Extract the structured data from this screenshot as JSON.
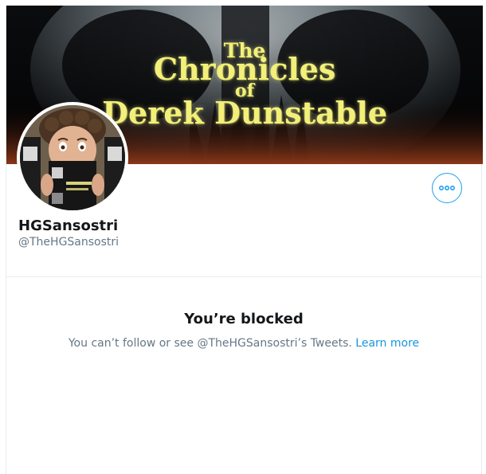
{
  "profile": {
    "banner": {
      "line1": "The",
      "line2": "Chronicles",
      "line3": "of",
      "line4": "Derek Dunstable"
    },
    "display_name": "HGSansostri",
    "handle": "@TheHGSansostri",
    "more_icon": "more-horizontal-icon"
  },
  "blocked": {
    "title": "You’re blocked",
    "message": "You can’t follow or see @TheHGSansostri’s Tweets.",
    "link_label": "Learn more"
  },
  "colors": {
    "accent": "#1da1f2",
    "link": "#1b95e0",
    "banner_text": "#f2f07a",
    "secondary_text": "#657786",
    "primary_text": "#14171a",
    "border": "#e6ecf0"
  }
}
